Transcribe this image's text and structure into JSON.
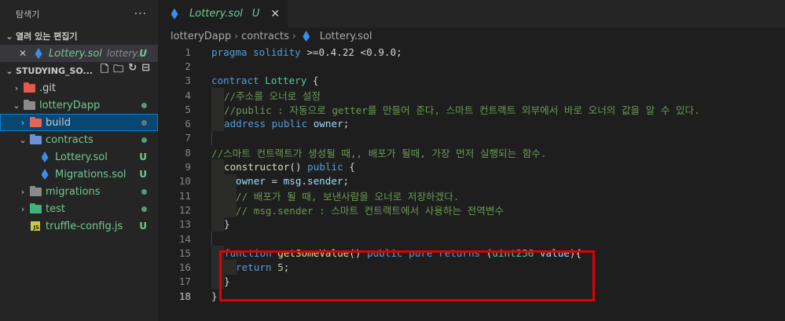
{
  "explorer": {
    "title": "탐색기",
    "more_icon": "ellipsis-icon",
    "open_editors": {
      "title": "열려 있는 편집기",
      "items": [
        {
          "name": "Lottery.sol",
          "path": "lottery...",
          "status": "U"
        }
      ]
    },
    "project": {
      "title": "STUDYING_SO...",
      "actions": [
        "new-file-icon",
        "new-folder-icon",
        "refresh-icon",
        "collapse-all-icon"
      ],
      "tree": [
        {
          "name": ".git",
          "type": "folder",
          "status": ""
        },
        {
          "name": "lotteryDapp",
          "type": "folder",
          "status": "•"
        },
        {
          "name": "build",
          "type": "folder",
          "status": "•"
        },
        {
          "name": "contracts",
          "type": "folder",
          "status": "•"
        },
        {
          "name": "Lottery.sol",
          "type": "file",
          "status": "U"
        },
        {
          "name": "Migrations.sol",
          "type": "file",
          "status": "U"
        },
        {
          "name": "migrations",
          "type": "folder",
          "status": "•"
        },
        {
          "name": "test",
          "type": "folder",
          "status": "•"
        },
        {
          "name": "truffle-config.js",
          "type": "file",
          "status": "U"
        }
      ]
    }
  },
  "editor": {
    "tab": {
      "name": "Lottery.sol",
      "status": "U"
    },
    "breadcrumbs": [
      "lotteryDapp",
      "contracts",
      "Lottery.sol"
    ],
    "line_numbers": [
      "1",
      "2",
      "3",
      "4",
      "5",
      "6",
      "7",
      "8",
      "9",
      "10",
      "11",
      "12",
      "13",
      "14",
      "15",
      "16",
      "17",
      "18"
    ],
    "code": {
      "l1": {
        "kw": "pragma",
        "kw2": "solidity",
        "rest": " >=0.4.22 <0.9.0;"
      },
      "l3": {
        "kw": "contract",
        "name": "Lottery",
        "rest": " {"
      },
      "l4": "//주소를 오너로 설정",
      "l5": "//public : 자동으로 getter를 만들어 준다, 스마트 컨트랙트 외부에서 바로 오너의 값을 알 수 있다.",
      "l6": {
        "type": "address",
        "kw": "public",
        "var": "owner",
        "end": ";"
      },
      "l8": "//스마트 컨트랙트가 생성될 때,, 배포가 될때, 가장 먼저 실행되는 함수.",
      "l9": {
        "fn": "constructor",
        "mid": "() ",
        "kw": "public",
        "end": " {"
      },
      "l10": {
        "var": "owner",
        "op": " = ",
        "obj": "msg",
        "dot": ".",
        "prop": "sender",
        "end": ";"
      },
      "l11": "// 배포가 될 때, 보낸사람을 오너로 저장하겠다.",
      "l12": "// msg.sender : 스마트 컨트랙트에서 사용하는 전역변수",
      "l13": "}",
      "l15": {
        "kw": "function",
        "fn": "getSomeValue",
        "mid": "() ",
        "kw2": "public",
        "kw3": "pure",
        "kw4": "returns",
        "open": " (",
        "type": "uint256",
        "param": "value",
        "close": "){"
      },
      "l16": {
        "kw": "return",
        "num": "5",
        "end": ";"
      },
      "l17": "}",
      "l18": "}"
    }
  },
  "colors": {
    "highlight_box": "#e00000",
    "modified": "#73c991",
    "keyword": "#569cd6",
    "comment": "#6a9955"
  }
}
